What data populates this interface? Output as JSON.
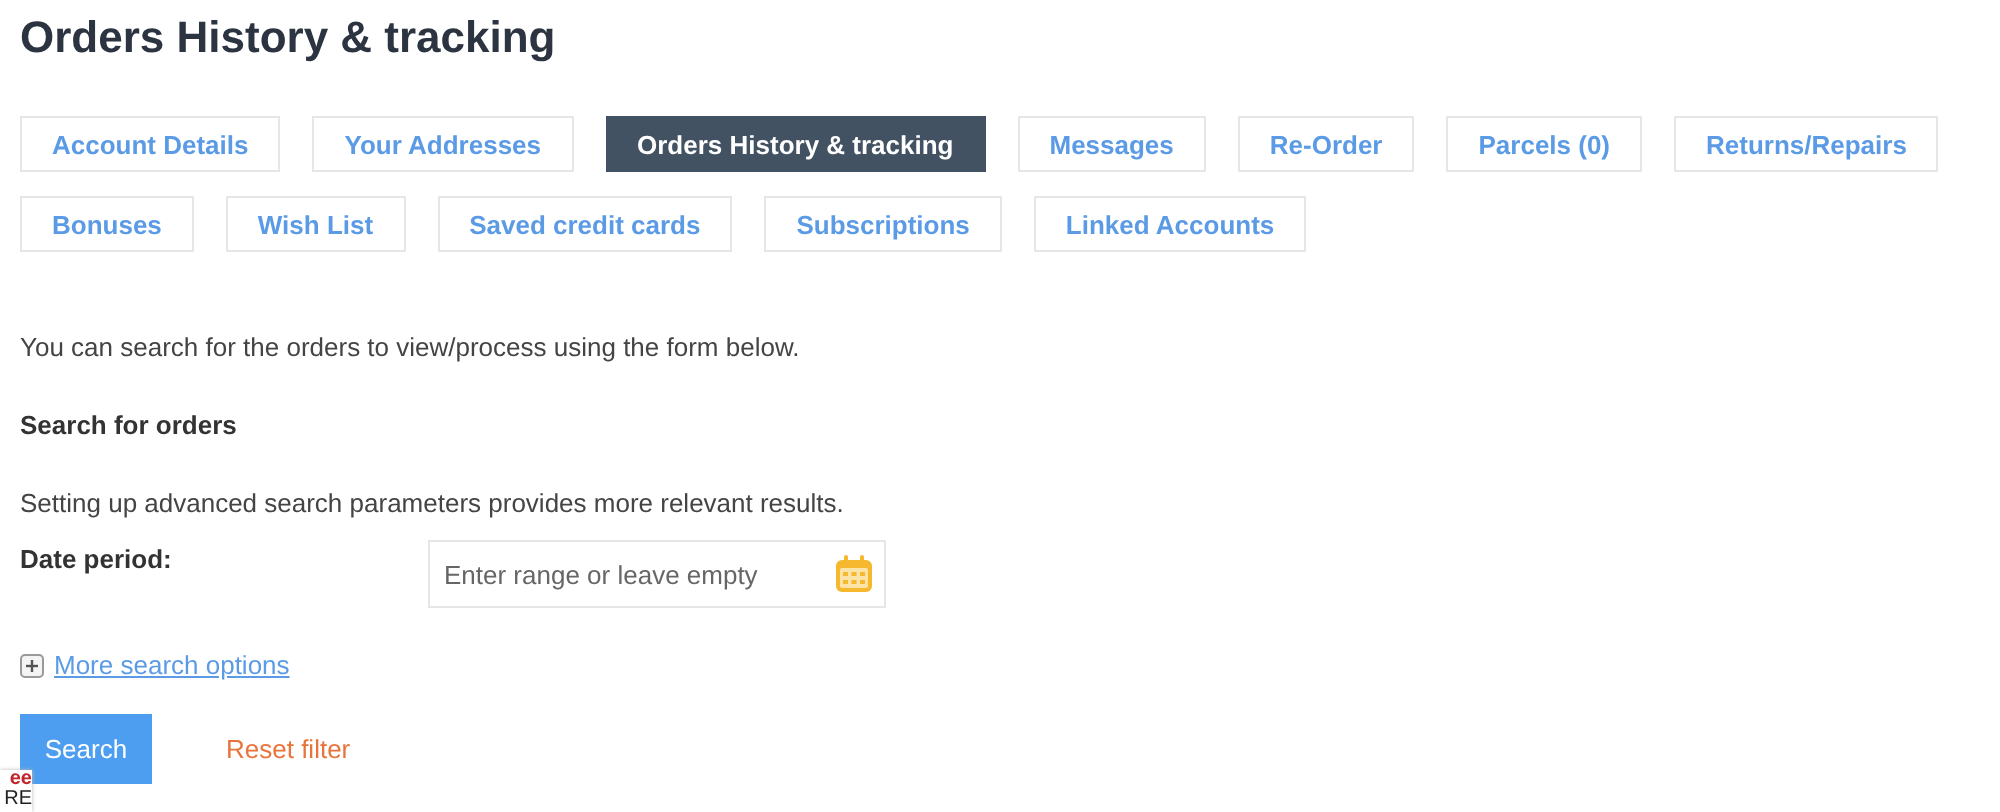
{
  "title": "Orders History & tracking",
  "tabs": [
    {
      "label": "Account Details",
      "selected": false
    },
    {
      "label": "Your Addresses",
      "selected": false
    },
    {
      "label": "Orders History & tracking",
      "selected": true
    },
    {
      "label": "Messages",
      "selected": false
    },
    {
      "label": "Re-Order",
      "selected": false
    },
    {
      "label": "Parcels (0)",
      "selected": false
    },
    {
      "label": "Returns/Repairs",
      "selected": false
    },
    {
      "label": "Bonuses",
      "selected": false
    },
    {
      "label": "Wish List",
      "selected": false
    },
    {
      "label": "Saved credit cards",
      "selected": false
    },
    {
      "label": "Subscriptions",
      "selected": false
    },
    {
      "label": "Linked Accounts",
      "selected": false
    }
  ],
  "intro": "You can search for the orders to view/process using the form below.",
  "search_heading": "Search for orders",
  "hint": "Setting up advanced search parameters provides more relevant results.",
  "date_field": {
    "label": "Date period:",
    "placeholder": "Enter range or leave empty"
  },
  "more_options": {
    "label": "More search options",
    "expanded": false
  },
  "buttons": {
    "search": "Search",
    "reset": "Reset filter"
  },
  "badge": {
    "line_1": "ee",
    "line_2": "RE"
  }
}
